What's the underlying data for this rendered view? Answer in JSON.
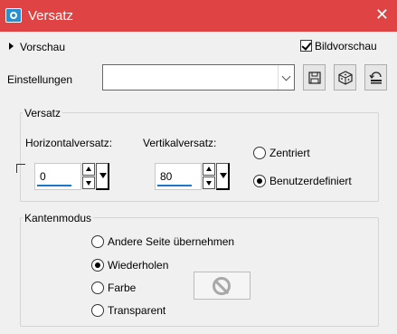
{
  "window": {
    "title": "Versatz",
    "icon": "camera-icon",
    "close_glyph": "✕"
  },
  "preview": {
    "label": "Vorschau",
    "image_preview_label": "Bildvorschau",
    "image_preview_checked": true
  },
  "settings": {
    "label": "Einstellungen",
    "value": ""
  },
  "offset_group": {
    "title": "Versatz",
    "horizontal_label": "Horizontalversatz:",
    "horizontal_value": "0",
    "vertical_label": "Vertikalversatz:",
    "vertical_value": "80",
    "options": [
      {
        "label": "Zentriert",
        "selected": false
      },
      {
        "label": "Benutzerdefiniert",
        "selected": true
      }
    ]
  },
  "edge_group": {
    "title": "Kantenmodus",
    "options": [
      {
        "label": "Andere Seite übernehmen",
        "selected": false
      },
      {
        "label": "Wiederholen",
        "selected": true
      },
      {
        "label": "Farbe",
        "selected": false
      },
      {
        "label": "Transparent",
        "selected": false
      }
    ]
  },
  "colors": {
    "titlebar": "#e04343",
    "accent": "#1e78c8"
  }
}
